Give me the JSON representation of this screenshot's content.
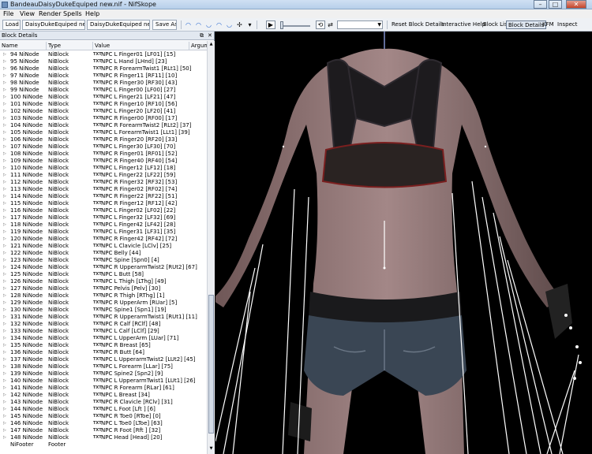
{
  "window": {
    "title": "BandeauDaisyDukeEquiped new.nif - NifSkope",
    "minimize": "–",
    "maximize": "□",
    "close": "✕"
  },
  "menu": [
    "File",
    "View",
    "Render",
    "Spells",
    "Help"
  ],
  "toolbar": {
    "load_label": "Load",
    "load_file": "DaisyDukeEquiped new.nif",
    "save_file": "DaisyDukeEquiped new.nif",
    "save_label": "Save As",
    "slider_value": "0.000",
    "reset_label": "Reset Block Details",
    "interactive_help": "Interactive Help",
    "block_list": "Block List",
    "block_details": "Block Details",
    "kfm": "KFM",
    "inspect": "Inspect"
  },
  "panel": {
    "title": "Block Details",
    "columns": {
      "name": "Name",
      "type": "Type",
      "value": "Value",
      "argument": "Argum"
    },
    "rows": [
      {
        "name": "94 NiNode",
        "type": "NiBlock",
        "value": "NPC L Finger01 [LF01] [15]"
      },
      {
        "name": "95 NiNode",
        "type": "NiBlock",
        "value": "NPC L Hand [LHnd] [23]"
      },
      {
        "name": "96 NiNode",
        "type": "NiBlock",
        "value": "NPC R ForearmTwist1 [RLt1] [50]"
      },
      {
        "name": "97 NiNode",
        "type": "NiBlock",
        "value": "NPC R Finger11 [RF11] [10]"
      },
      {
        "name": "98 NiNode",
        "type": "NiBlock",
        "value": "NPC R Finger30 [RF30] [43]"
      },
      {
        "name": "99 NiNode",
        "type": "NiBlock",
        "value": "NPC L Finger00 [LF00] [27]"
      },
      {
        "name": "100 NiNode",
        "type": "NiBlock",
        "value": "NPC L Finger21 [LF21] [47]"
      },
      {
        "name": "101 NiNode",
        "type": "NiBlock",
        "value": "NPC R Finger10 [RF10] [56]"
      },
      {
        "name": "102 NiNode",
        "type": "NiBlock",
        "value": "NPC L Finger20 [LF20] [41]"
      },
      {
        "name": "103 NiNode",
        "type": "NiBlock",
        "value": "NPC R Finger00 [RF00] [17]"
      },
      {
        "name": "104 NiNode",
        "type": "NiBlock",
        "value": "NPC R ForearmTwist2 [RLt2] [37]"
      },
      {
        "name": "105 NiNode",
        "type": "NiBlock",
        "value": "NPC L ForearmTwist1 [LLt1] [39]"
      },
      {
        "name": "106 NiNode",
        "type": "NiBlock",
        "value": "NPC R Finger20 [RF20] [33]"
      },
      {
        "name": "107 NiNode",
        "type": "NiBlock",
        "value": "NPC L Finger30 [LF30] [70]"
      },
      {
        "name": "108 NiNode",
        "type": "NiBlock",
        "value": "NPC R Finger01 [RF01] [52]"
      },
      {
        "name": "109 NiNode",
        "type": "NiBlock",
        "value": "NPC R Finger40 [RF40] [54]"
      },
      {
        "name": "110 NiNode",
        "type": "NiBlock",
        "value": "NPC L Finger12 [LF12] [18]"
      },
      {
        "name": "111 NiNode",
        "type": "NiBlock",
        "value": "NPC L Finger22 [LF22] [59]"
      },
      {
        "name": "112 NiNode",
        "type": "NiBlock",
        "value": "NPC R Finger32 [RF32] [53]"
      },
      {
        "name": "113 NiNode",
        "type": "NiBlock",
        "value": "NPC R Finger02 [RF02] [74]"
      },
      {
        "name": "114 NiNode",
        "type": "NiBlock",
        "value": "NPC R Finger22 [RF22] [51]"
      },
      {
        "name": "115 NiNode",
        "type": "NiBlock",
        "value": "NPC R Finger12 [RF12] [42]"
      },
      {
        "name": "116 NiNode",
        "type": "NiBlock",
        "value": "NPC L Finger02 [LF02] [22]"
      },
      {
        "name": "117 NiNode",
        "type": "NiBlock",
        "value": "NPC L Finger32 [LF32] [69]"
      },
      {
        "name": "118 NiNode",
        "type": "NiBlock",
        "value": "NPC L Finger42 [LF42] [28]"
      },
      {
        "name": "119 NiNode",
        "type": "NiBlock",
        "value": "NPC L Finger31 [LF31] [35]"
      },
      {
        "name": "120 NiNode",
        "type": "NiBlock",
        "value": "NPC R Finger42 [RF42] [72]"
      },
      {
        "name": "121 NiNode",
        "type": "NiBlock",
        "value": "NPC L Clavicle [LClv] [25]"
      },
      {
        "name": "122 NiNode",
        "type": "NiBlock",
        "value": "NPC Belly [44]"
      },
      {
        "name": "123 NiNode",
        "type": "NiBlock",
        "value": "NPC Spine [Spn0] [4]"
      },
      {
        "name": "124 NiNode",
        "type": "NiBlock",
        "value": "NPC R UpperarmTwist2 [RUt2] [67]"
      },
      {
        "name": "125 NiNode",
        "type": "NiBlock",
        "value": "NPC L Butt [58]"
      },
      {
        "name": "126 NiNode",
        "type": "NiBlock",
        "value": "NPC L Thigh [LThg] [49]"
      },
      {
        "name": "127 NiNode",
        "type": "NiBlock",
        "value": "NPC Pelvis [Pelv] [30]"
      },
      {
        "name": "128 NiNode",
        "type": "NiBlock",
        "value": "NPC R Thigh [RThg] [1]"
      },
      {
        "name": "129 NiNode",
        "type": "NiBlock",
        "value": "NPC R UpperArm [RUar] [5]"
      },
      {
        "name": "130 NiNode",
        "type": "NiBlock",
        "value": "NPC Spine1 [Spn1] [19]"
      },
      {
        "name": "131 NiNode",
        "type": "NiBlock",
        "value": "NPC R UpperarmTwist1 [RUt1] [11]"
      },
      {
        "name": "132 NiNode",
        "type": "NiBlock",
        "value": "NPC R Calf [RClf] [48]"
      },
      {
        "name": "133 NiNode",
        "type": "NiBlock",
        "value": "NPC L Calf [LClf] [29]"
      },
      {
        "name": "134 NiNode",
        "type": "NiBlock",
        "value": "NPC L UpperArm [LUar] [71]"
      },
      {
        "name": "135 NiNode",
        "type": "NiBlock",
        "value": "NPC R Breast [65]"
      },
      {
        "name": "136 NiNode",
        "type": "NiBlock",
        "value": "NPC R Butt [64]"
      },
      {
        "name": "137 NiNode",
        "type": "NiBlock",
        "value": "NPC L UpperarmTwist2 [LUt2] [45]"
      },
      {
        "name": "138 NiNode",
        "type": "NiBlock",
        "value": "NPC L Forearm [LLar] [75]"
      },
      {
        "name": "139 NiNode",
        "type": "NiBlock",
        "value": "NPC Spine2 [Spn2] [9]"
      },
      {
        "name": "140 NiNode",
        "type": "NiBlock",
        "value": "NPC L UpperarmTwist1 [LUt1] [26]"
      },
      {
        "name": "141 NiNode",
        "type": "NiBlock",
        "value": "NPC R Forearm [RLar] [61]"
      },
      {
        "name": "142 NiNode",
        "type": "NiBlock",
        "value": "NPC L Breast [34]"
      },
      {
        "name": "143 NiNode",
        "type": "NiBlock",
        "value": "NPC R Clavicle [RClv] [31]"
      },
      {
        "name": "144 NiNode",
        "type": "NiBlock",
        "value": "NPC L Foot [Lft ] [6]"
      },
      {
        "name": "145 NiNode",
        "type": "NiBlock",
        "value": "NPC R Toe0 [RToe] [0]"
      },
      {
        "name": "146 NiNode",
        "type": "NiBlock",
        "value": "NPC L Toe0 [LToe] [63]"
      },
      {
        "name": "147 NiNode",
        "type": "NiBlock",
        "value": "NPC R Foot [Rft ] [32]"
      },
      {
        "name": "148 NiNode",
        "type": "NiBlock",
        "value": "NPC Head [Head] [20]"
      },
      {
        "name": "NiFooter",
        "type": "Footer",
        "value": ""
      }
    ]
  },
  "icons": {
    "txt": "TXT",
    "expand": "▷"
  }
}
